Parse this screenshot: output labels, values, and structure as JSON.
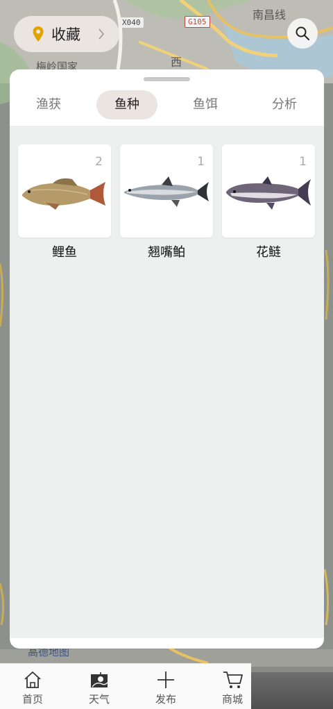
{
  "header": {
    "favorites_label": "收藏"
  },
  "map_labels": {
    "road_x040": "X040",
    "road_g105": "G105",
    "place_nanchang": "南昌线",
    "place_xi": "西",
    "place_meiling": "梅岭国家",
    "place_amap": "高德地图"
  },
  "tabs": [
    {
      "label": "渔获"
    },
    {
      "label": "鱼种"
    },
    {
      "label": "鱼饵"
    },
    {
      "label": "分析"
    }
  ],
  "active_tab": "鱼种",
  "fish": [
    {
      "name": "鲤鱼",
      "count": "2"
    },
    {
      "name": "翘嘴鲌",
      "count": "1"
    },
    {
      "name": "花鲢",
      "count": "1"
    }
  ],
  "bottom_nav": [
    {
      "label": "首页",
      "icon": "home-icon"
    },
    {
      "label": "天气",
      "icon": "weather-icon"
    },
    {
      "label": "发布",
      "icon": "plus-icon"
    },
    {
      "label": "商城",
      "icon": "cart-icon"
    }
  ],
  "colors": {
    "active_tab_bg": "#ece4e0",
    "content_bg": "#eef0ef",
    "pin_color": "#e2a300"
  }
}
